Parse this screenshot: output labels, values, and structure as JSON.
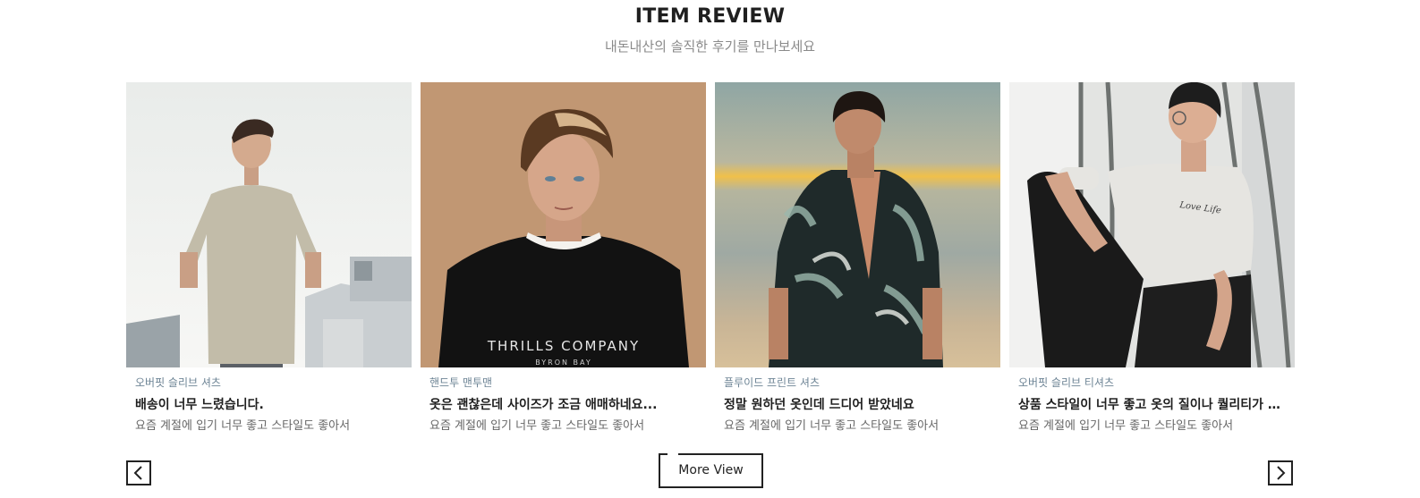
{
  "section": {
    "title": "ITEM REVIEW",
    "subtitle": "내돈내산의 솔직한 후기를 만나보세요"
  },
  "reviews": [
    {
      "category": "오버핏 슬리브 셔츠",
      "headline": "배송이 너무 느렸습니다.",
      "text": "요즘 계절에 입기 너무 좋고 스타일도 좋아서"
    },
    {
      "category": "핸드투 맨투맨",
      "headline": "옷은 괜찮은데 사이즈가 조금 애매하네요...",
      "text": "요즘 계절에 입기 너무 좋고 스타일도 좋아서",
      "shirt_print": "THRILLS COMPANY",
      "shirt_print_sub": "BYRON BAY"
    },
    {
      "category": "플루이드 프린트 셔츠",
      "headline": "정말 원하던 옷인데 드디어 받았네요",
      "text": "요즘 계절에 입기 너무 좋고 스타일도 좋아서"
    },
    {
      "category": "오버핏 슬리브 티셔츠",
      "headline": "상품 스타일이 너무 좋고 옷의 질이나 퀄리티가 기대 ...",
      "text": "요즘 계절에 입기 너무 좋고 스타일도 좋아서",
      "shirt_print": "Love Life"
    }
  ],
  "controls": {
    "more_label": "More View",
    "prev_icon": "chevron-left-icon",
    "next_icon": "chevron-right-icon"
  }
}
